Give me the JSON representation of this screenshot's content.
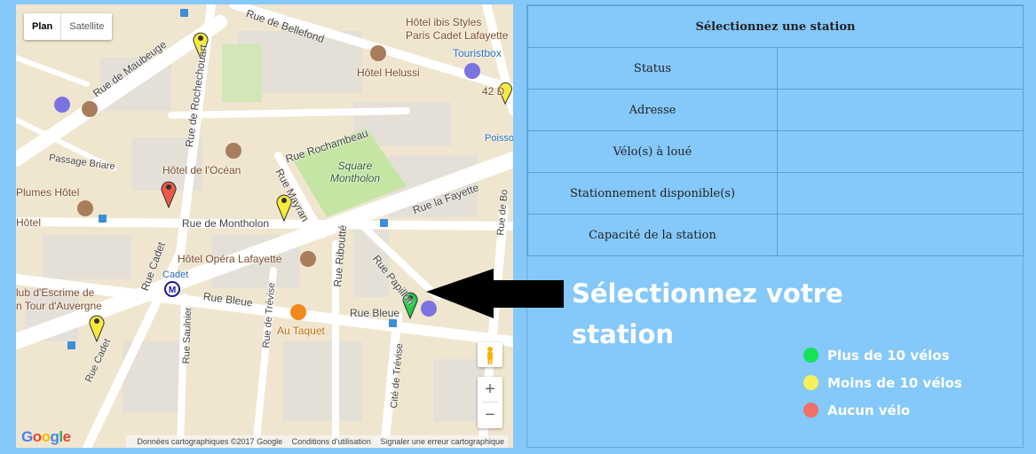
{
  "map": {
    "map_type": {
      "plan": "Plan",
      "satellite": "Satellite"
    },
    "labels": {
      "rue_de_bellefond": "Rue de Bellefond",
      "hotel_ibis": "Hôtel ibis Styles",
      "hotel_ibis_2": "Paris Cadet Lafayette",
      "touristbox": "Touristbox",
      "hotel_helussi": "Hôtel Helussi",
      "rue_de_maubeuge": "Rue de Maubeuge",
      "rue_de_rochechouart": "Rue de Rochechouart",
      "rue_rochambeau": "Rue Rochambeau",
      "passage_briare": "Passage Briare",
      "hotel_de_locean": "Hôtel de l'Océan",
      "square_montholon_1": "Square",
      "square_montholon_2": "Montholon",
      "plumes_hotel": "Plumes Hôtel",
      "rue_la_fayette": "Rue la Fayette",
      "hotel_left": "Hôtel",
      "rue_de_montholon": "Rue de Montholon",
      "rue_mayran": "Rue Mayran",
      "rue_cadet": "Rue Cadet",
      "hotel_opera_lafayette": "Hôtel Opéra Lafayette",
      "rue_riboutte": "Rue Riboutté",
      "rue_papillon": "Rue Papillon",
      "cadet": "Cadet",
      "club_escrime_1": "lub d'Escrime de",
      "club_escrime_2": "n Tour d'Auvergne",
      "rue_bleue_1": "Rue Bleue",
      "rue_bleue_2": "Rue Bleue",
      "au_taquet": "Au Taquet",
      "rue_saulnier": "Rue Saulnier",
      "rue_de_treviise": "Rue de Trévise",
      "cite_de_trevise": "Cité de Trévise",
      "rue_cadet_2": "Rue Cadet",
      "rue_bleue_right": "Rue Bleue",
      "poissonniere": "Poisso",
      "label_42": "42 D",
      "rue_de_bon": "Rue de Bo"
    },
    "zoom": {
      "in": "+",
      "out": "−"
    },
    "google_logo": [
      "G",
      "o",
      "o",
      "g",
      "l",
      "e"
    ],
    "footer": {
      "data": "Données cartographiques ©2017 Google",
      "terms": "Conditions d'utilisation",
      "report": "Signaler une erreur cartographique"
    }
  },
  "table": {
    "header": "Sélectionnez une station",
    "rows": [
      "Status",
      "Adresse",
      "Vélo(s) à loué",
      "Stationnement disponible(s)",
      "Capacité de la station"
    ]
  },
  "instruction": "Sélectionnez votre station",
  "legend": [
    {
      "label": "Plus de 10 vélos",
      "color": "#14e35a"
    },
    {
      "label": "Moins de 10 vélos",
      "color": "#f7f05a"
    },
    {
      "label": "Aucun vélo",
      "color": "#f07068"
    }
  ],
  "colors": {
    "background": "#85c8fa",
    "marker_green": "#22c94a",
    "marker_yellow": "#f6ea3a",
    "marker_red": "#ea5848"
  }
}
